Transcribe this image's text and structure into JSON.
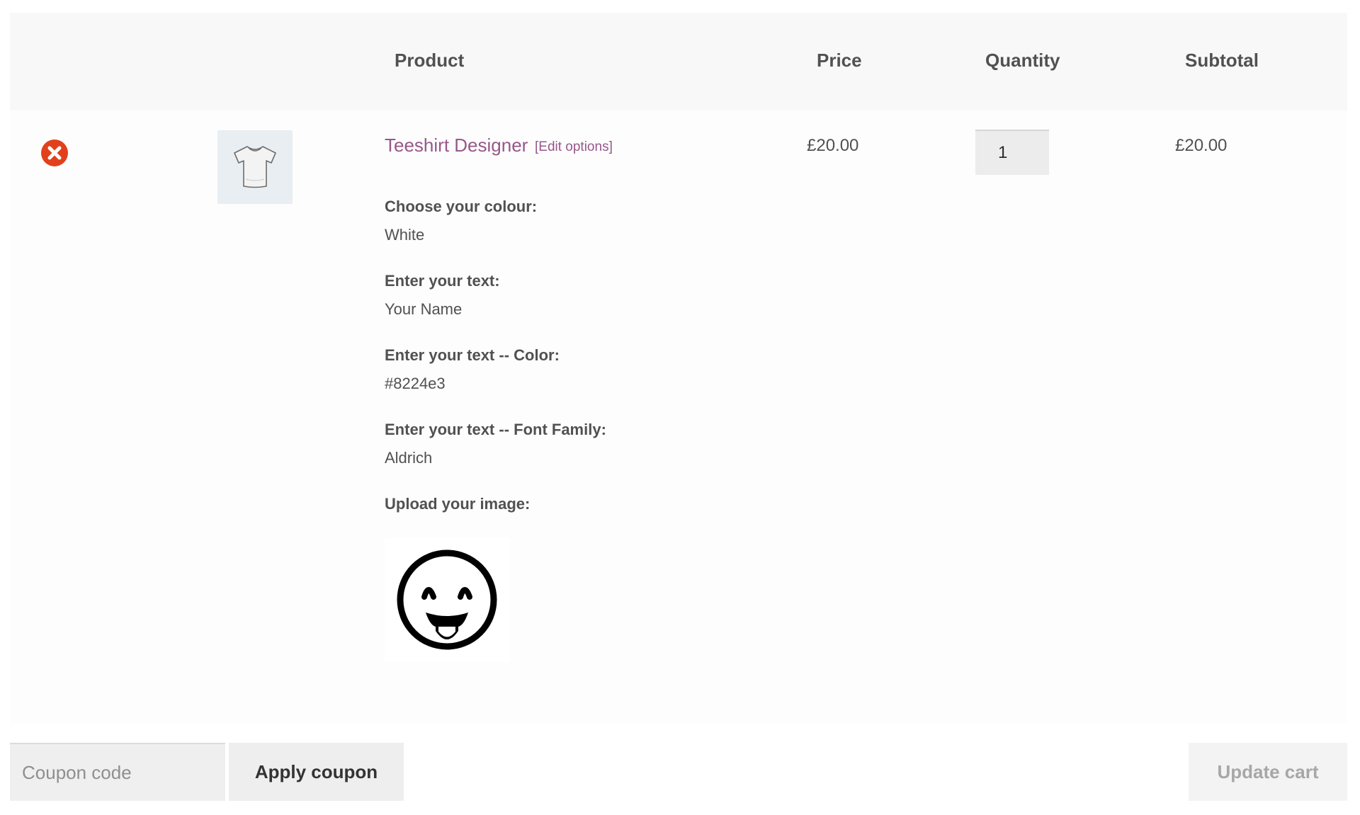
{
  "table": {
    "headers": {
      "product": "Product",
      "price": "Price",
      "quantity": "Quantity",
      "subtotal": "Subtotal"
    }
  },
  "item": {
    "remove_icon": "remove-circle-x-icon",
    "thumbnail_icon": "tshirt-icon",
    "name": "Teeshirt Designer",
    "edit_link": "[Edit options]",
    "meta": [
      {
        "label": "Choose your colour:",
        "value": "White"
      },
      {
        "label": "Enter your text:",
        "value": "Your Name"
      },
      {
        "label": "Enter your text -- Color:",
        "value": "#8224e3"
      },
      {
        "label": "Enter your text -- Font Family:",
        "value": "Aldrich"
      },
      {
        "label": "Upload your image:",
        "value": ""
      }
    ],
    "uploaded_image_icon": "tongue-out-smiley-icon",
    "price": "£20.00",
    "quantity": "1",
    "subtotal": "£20.00"
  },
  "actions": {
    "coupon_placeholder": "Coupon code",
    "apply_coupon": "Apply coupon",
    "update_cart": "Update cart"
  },
  "colors": {
    "link": "#96588a",
    "remove": "#e2401c",
    "text": "#515151"
  }
}
